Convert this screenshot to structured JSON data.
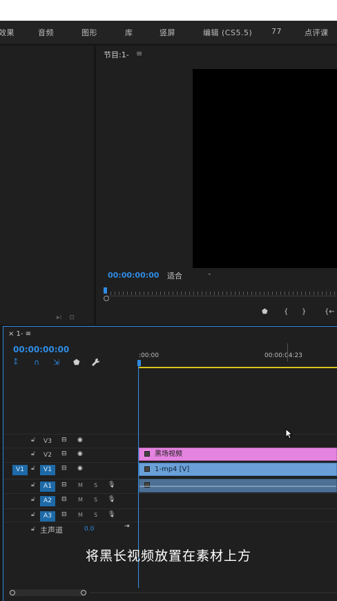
{
  "menu": [
    "效果",
    "音频",
    "图形",
    "库",
    "竖屏",
    "编辑 (CS5.5)",
    "77",
    "点评课"
  ],
  "program_monitor": {
    "title": "节目:1-",
    "menu_icon": "hamburger-icon",
    "timecode": "00:00:00:00",
    "fit": "适合",
    "transport_icons": [
      "add-marker-icon",
      "mark-in-icon",
      "mark-out-icon",
      "go-to-in-icon"
    ],
    "transport_glyphs": [
      "⬟",
      "{",
      "}",
      "{←"
    ]
  },
  "left_panel": {
    "footer_icons": [
      "▸⁞",
      "⊡"
    ]
  },
  "timeline": {
    "tab": "× 1- ≡",
    "timecode": "00:00:00:00",
    "tools": [
      "snap-icon",
      "linked-selection-icon",
      "add-marker-icon",
      "timeline-display-settings-icon",
      "wrench-icon"
    ],
    "tool_glyphs": [
      "⁑",
      "∩",
      "⇲",
      "⬟",
      "🔧"
    ],
    "ruler_start": ":00:00",
    "ruler_mid": "00:00:04:23",
    "video_tracks": [
      {
        "name": "V3",
        "source": "",
        "active": false
      },
      {
        "name": "V2",
        "source": "",
        "active": false
      },
      {
        "name": "V1",
        "source": "V1",
        "active": true
      }
    ],
    "audio_tracks": [
      {
        "name": "A1",
        "m": "M",
        "s": "S"
      },
      {
        "name": "A2",
        "m": "M",
        "s": "S"
      },
      {
        "name": "A3",
        "m": "M",
        "s": "S"
      }
    ],
    "clips": {
      "v2": "黑场视频",
      "v1": "1-mp4 [V]"
    },
    "master": {
      "label": "主声道",
      "value": "0.0"
    }
  },
  "subtitle": "将黑长视频放置在素材上方",
  "colors": {
    "accent": "#2f8be3",
    "black_video_clip": "#e584e0",
    "video_clip": "#6aa0d8",
    "audio_clip": "#4c6f94",
    "work_area": "#d9c31c"
  }
}
